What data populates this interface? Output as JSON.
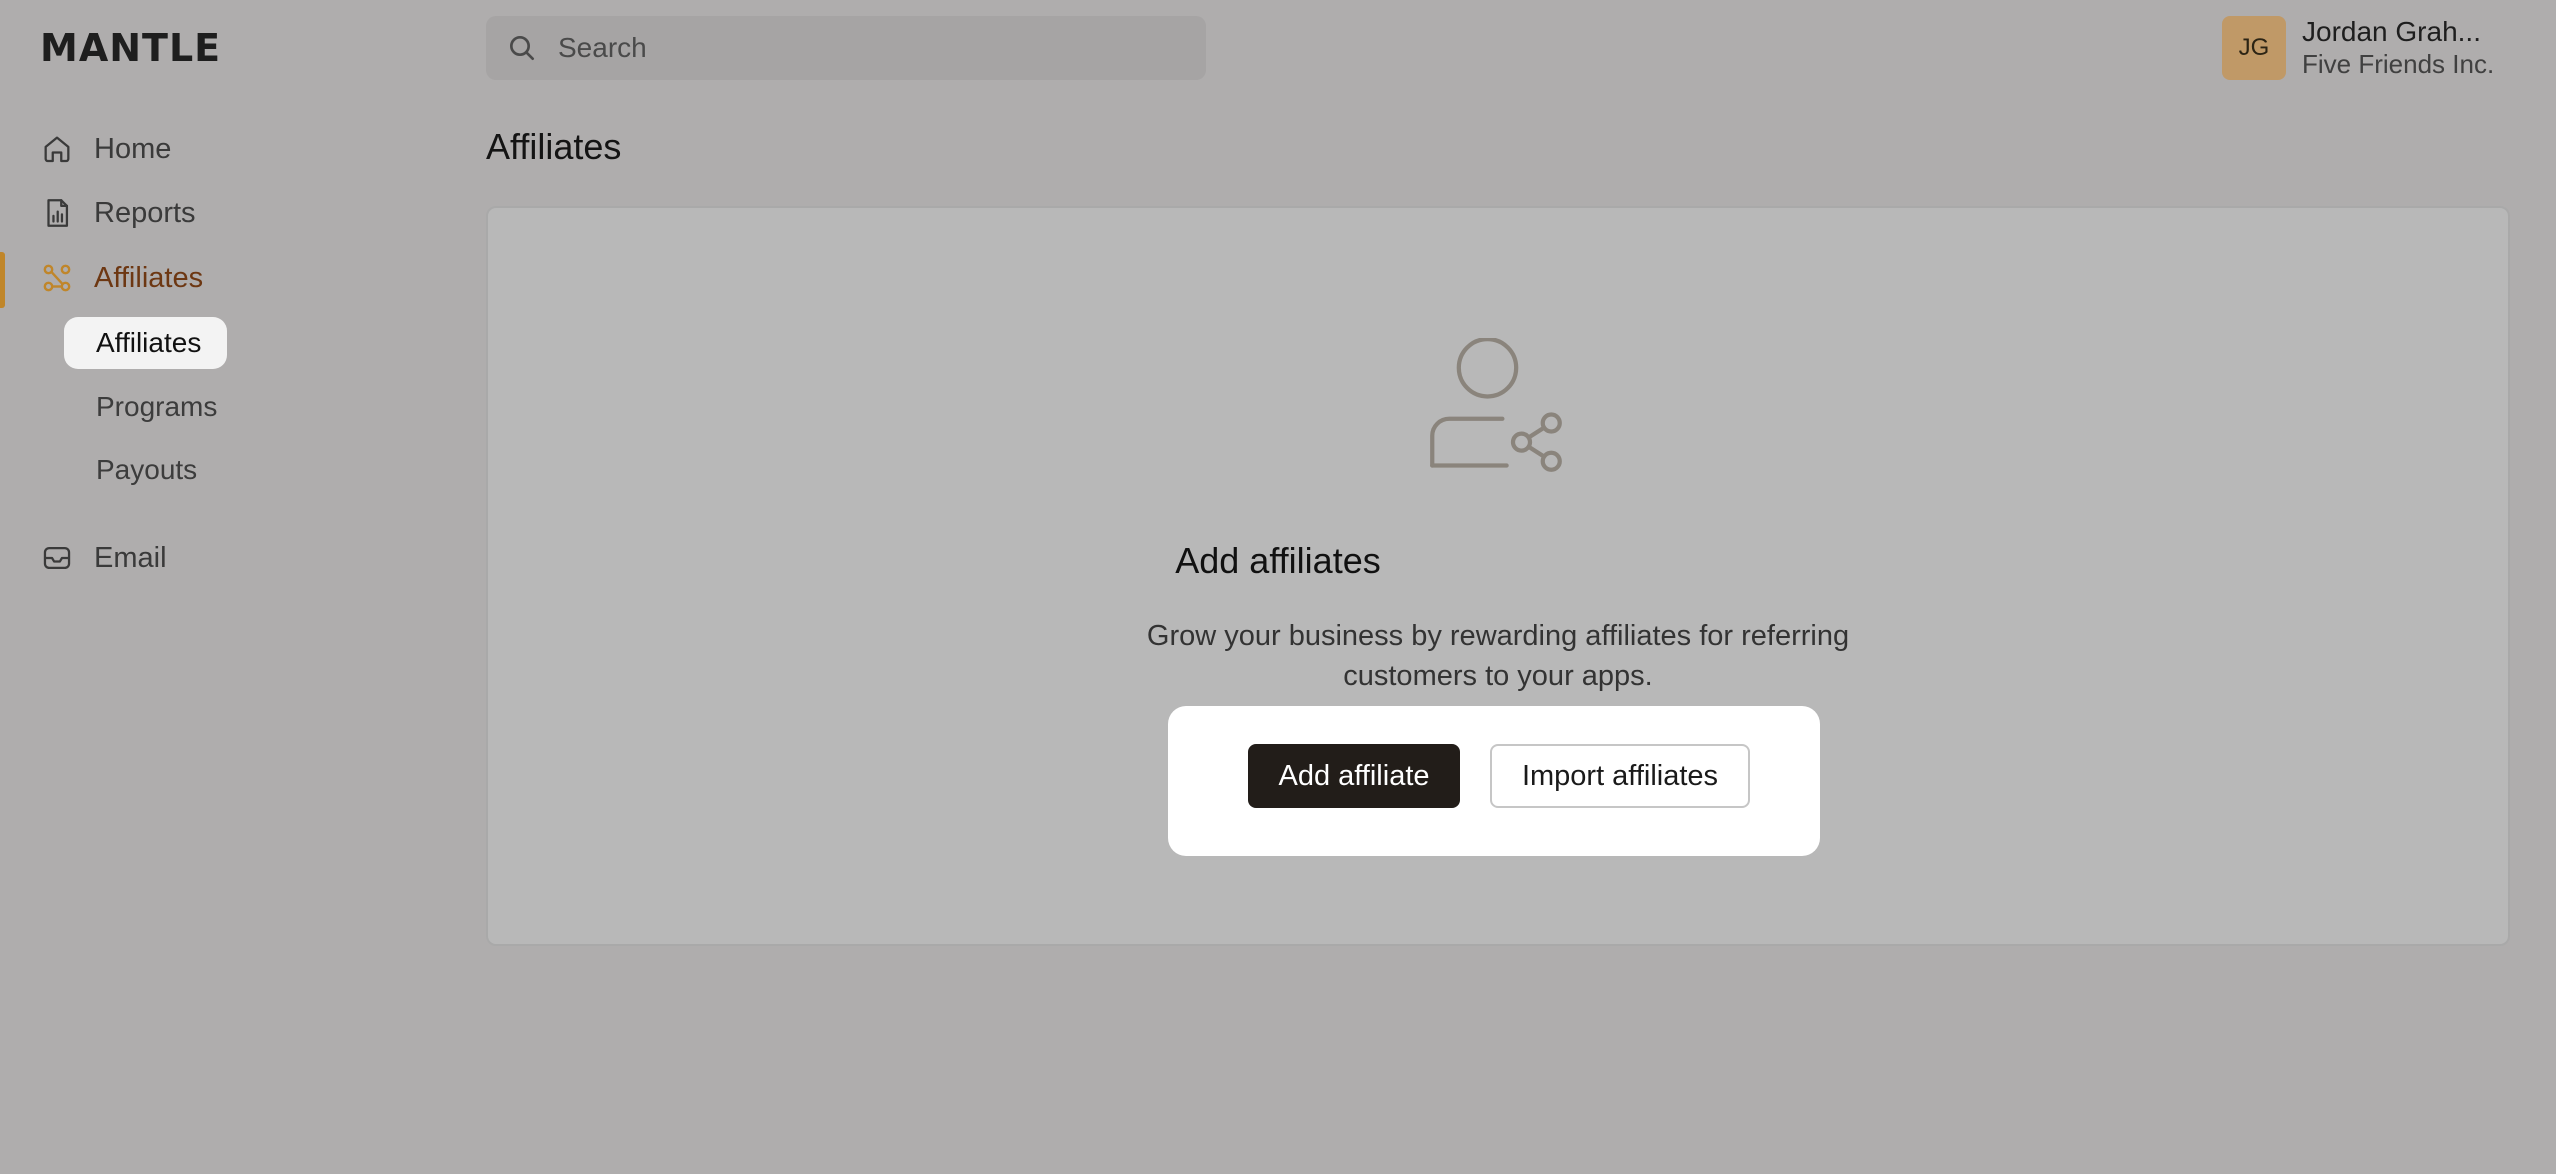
{
  "app": {
    "logo": "MANTLE"
  },
  "search": {
    "placeholder": "Search",
    "value": ""
  },
  "user": {
    "initials": "JG",
    "name": "Jordan Grah...",
    "org": "Five Friends Inc."
  },
  "sidebar": {
    "items": [
      {
        "label": "Home",
        "icon": "home-icon"
      },
      {
        "label": "Reports",
        "icon": "report-icon"
      },
      {
        "label": "Affiliates",
        "icon": "affiliates-icon",
        "active": true
      },
      {
        "label": "Email",
        "icon": "mail-icon"
      }
    ],
    "sub_items": [
      {
        "label": "Affiliates",
        "active": true
      },
      {
        "label": "Programs"
      },
      {
        "label": "Payouts"
      }
    ]
  },
  "page": {
    "title": "Affiliates"
  },
  "empty_state": {
    "icon": "user-share-icon",
    "title": "Add affiliates",
    "description": "Grow your business by rewarding affiliates for referring customers to your apps.",
    "primary_button": "Add affiliate",
    "secondary_button": "Import affiliates"
  },
  "colors": {
    "accent": "#c0862a",
    "active_text": "#6d3712",
    "avatar_bg": "#c09967",
    "primary_button": "#221d19"
  }
}
